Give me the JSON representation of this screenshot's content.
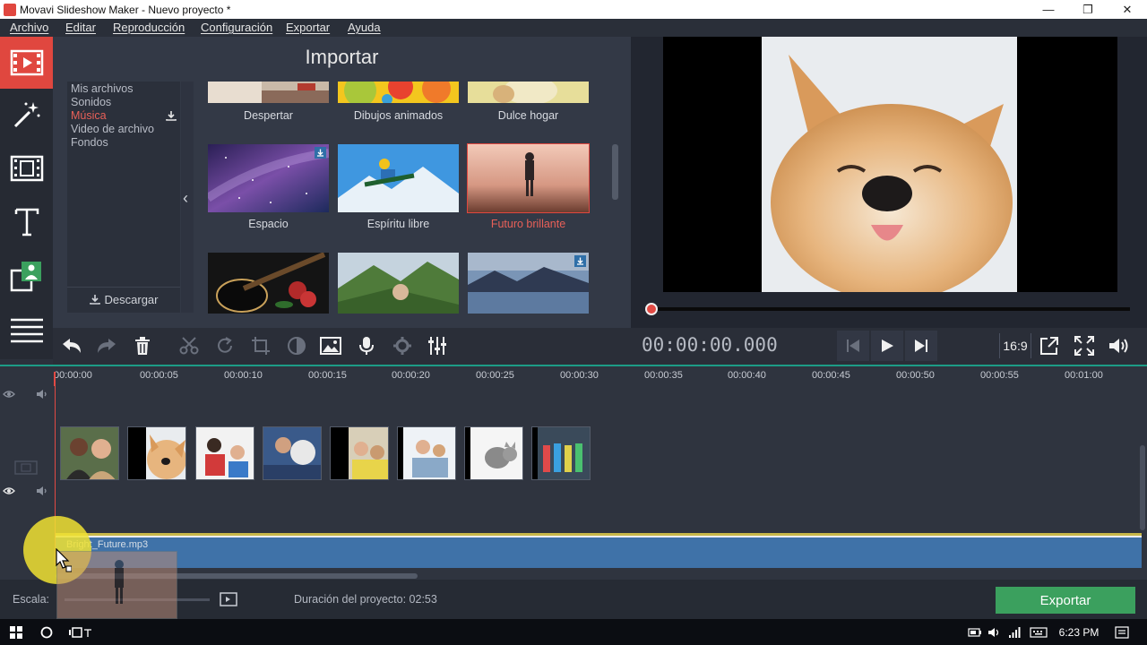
{
  "window": {
    "title": "Movavi Slideshow Maker - Nuevo proyecto *",
    "minimize_glyph": "—",
    "restore_glyph": "❐",
    "close_glyph": "✕"
  },
  "menu": [
    "Archivo",
    "Editar",
    "Reproducción",
    "Configuración",
    "Exportar",
    "Ayuda"
  ],
  "left_tools": [
    "import-icon",
    "magic-wand-icon",
    "film-transition-icon",
    "text-icon",
    "overlay-icon",
    "list-icon"
  ],
  "import_panel": {
    "title": "Importar",
    "categories": [
      "Mis archivos",
      "Sonidos",
      "Música",
      "Video de archivo",
      "Fondos"
    ],
    "active_category": "Música",
    "download_label": "Descargar",
    "collapse_glyph": "‹",
    "items": [
      {
        "label": "Despertar"
      },
      {
        "label": "Dibujos animados"
      },
      {
        "label": "Dulce hogar"
      },
      {
        "label": "Espacio"
      },
      {
        "label": "Espíritu libre"
      },
      {
        "label": "Futuro brillante"
      }
    ],
    "selected_item": "Futuro brillante"
  },
  "player": {
    "timecode": "00:00:00.000",
    "aspect_ratio": "16:9",
    "position_fraction": 0
  },
  "timeline": {
    "ticks": [
      "00:00:00",
      "00:00:05",
      "00:00:10",
      "00:00:15",
      "00:00:20",
      "00:00:25",
      "00:00:30",
      "00:00:35",
      "00:00:40",
      "00:00:45",
      "00:00:50",
      "00:00:55",
      "00:01:00"
    ],
    "audio_clip_label": "Bright_Future.mp3",
    "clip_count": 8
  },
  "bottom": {
    "scale_label": "Escala:",
    "duration_label": "Duración del proyecto:  02:53",
    "export_label": "Exportar"
  },
  "taskbar": {
    "time": "6:23 PM"
  },
  "colors": {
    "accent_red": "#e0473f",
    "export_green": "#3ba05e",
    "audio_blue": "#3f72a8",
    "ruler_teal": "#1c9c86"
  }
}
